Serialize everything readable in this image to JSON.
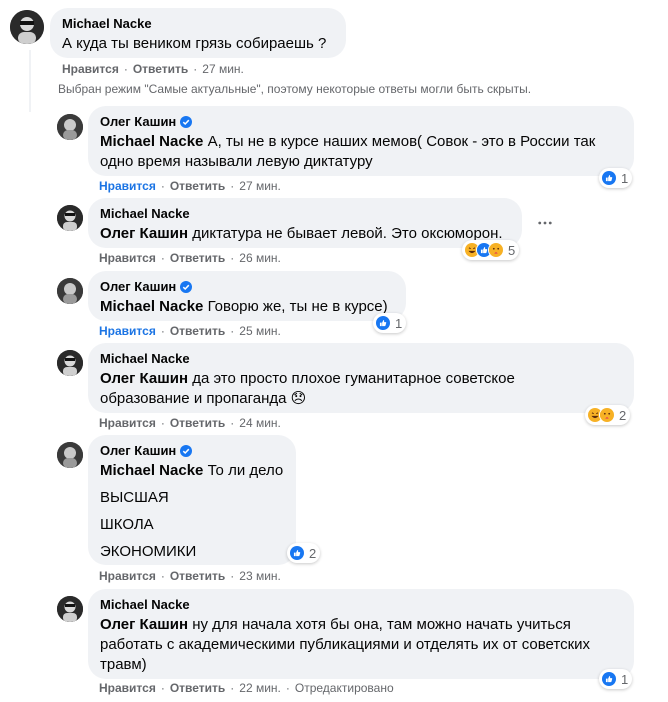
{
  "actions": {
    "like": "Нравится",
    "reply": "Ответить",
    "edited": "Отредактировано"
  },
  "notice": "Выбран режим \"Самые актуальные\", поэтому некоторые ответы могли быть скрыты.",
  "comments": [
    {
      "author": "Michael Nacke",
      "mention": "",
      "lines": [
        "А куда ты веником грязь собираешь ?"
      ],
      "time": "27 мин.",
      "liked": false
    },
    {
      "author": "Олег Кашин",
      "verified": true,
      "mention": "Michael Nacke",
      "lines": [
        "А, ты не в курсе наших мемов( Совок - это в России так",
        "одно время называли левую диктатуру"
      ],
      "time": "27 мин.",
      "liked": true,
      "reaction_count": "1"
    },
    {
      "author": "Michael Nacke",
      "mention": "Олег Кашин",
      "lines": [
        "диктатура не бывает левой. Это оксюморон."
      ],
      "time": "26 мин.",
      "liked": false,
      "reaction_count": "5"
    },
    {
      "author": "Олег Кашин",
      "verified": true,
      "mention": "Michael Nacke",
      "lines": [
        "Говорю же, ты не в курсе)"
      ],
      "time": "25 мин.",
      "liked": true,
      "reaction_count": "1"
    },
    {
      "author": "Michael Nacke",
      "mention": "Олег Кашин",
      "lines": [
        "да это просто плохое гуманитарное советское",
        "образование и пропаганда 😞"
      ],
      "time": "24 мин.",
      "liked": false,
      "reaction_count": "2"
    },
    {
      "author": "Олег Кашин",
      "verified": true,
      "mention": "Michael Nacke",
      "lines": [
        "То ли дело",
        "ВЫСШАЯ",
        "ШКОЛА",
        "ЭКОНОМИКИ"
      ],
      "time": "23 мин.",
      "liked": false,
      "reaction_count": "2"
    },
    {
      "author": "Michael Nacke",
      "mention": "Олег Кашин",
      "lines": [
        "ну для начала хотя бы она, там можно начать учиться",
        "работать с академическими публикациями и отделять их от советских",
        "травм)"
      ],
      "time": "22 мин.",
      "liked": false,
      "edited": true,
      "reaction_count": "1"
    }
  ],
  "colors": {
    "like_blue": "#1b74e4",
    "bubble_bg": "#f0f2f5",
    "meta_gray": "#65676b",
    "verified_blue": "#1877f2"
  },
  "icons": {
    "more": "more-horizontal-icon",
    "verified": "verified-badge-icon",
    "like": "like-reaction-icon",
    "haha": "haha-reaction-icon",
    "care": "care-reaction-icon"
  }
}
